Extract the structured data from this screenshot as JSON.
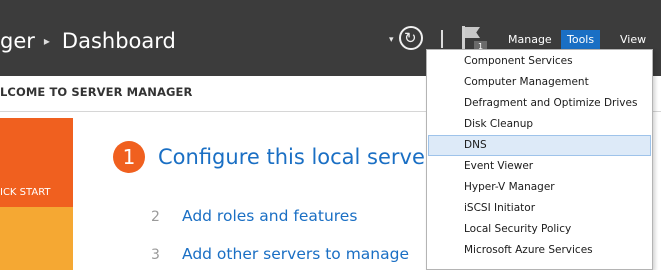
{
  "titlebar": {
    "breadcrumb_app": "ger",
    "breadcrumb_separator": "▸",
    "breadcrumb_page": "Dashboard",
    "notification_count": "1",
    "menus": {
      "manage": "Manage",
      "tools": "Tools",
      "view": "View"
    }
  },
  "welcome": {
    "title": "LCOME TO SERVER MANAGER"
  },
  "tiles": {
    "quick_start": "ICK START"
  },
  "steps": [
    {
      "number": "1",
      "label": "Configure this local server"
    },
    {
      "number": "2",
      "label": "Add roles and features"
    },
    {
      "number": "3",
      "label": "Add other servers to manage"
    }
  ],
  "tools_menu": {
    "items": [
      "Component Services",
      "Computer Management",
      "Defragment and Optimize Drives",
      "Disk Cleanup",
      "DNS",
      "Event Viewer",
      "Hyper-V Manager",
      "iSCSI Initiator",
      "Local Security Policy",
      "Microsoft Azure Services"
    ],
    "highlighted": "DNS"
  },
  "colors": {
    "titlebar_bg": "#3c3c3c",
    "accent_blue": "#1a6fc4",
    "orange": "#f0601f",
    "yellow": "#f5a833",
    "menu_highlight": "#ddeaf8"
  }
}
